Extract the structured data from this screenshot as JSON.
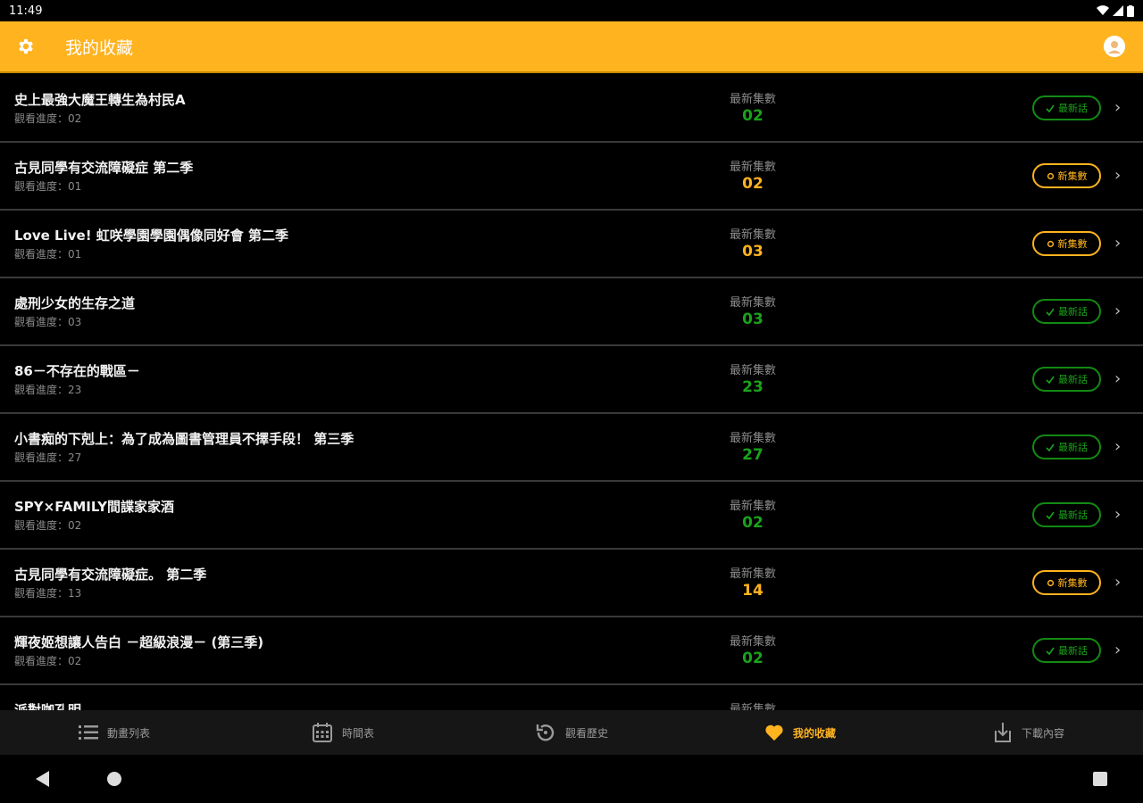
{
  "status_bar": {
    "time": "11:49"
  },
  "app_bar": {
    "title": "我的收藏"
  },
  "list": {
    "latest_label": "最新集數",
    "items": [
      {
        "name": "史上最強大魔王轉生為村民A",
        "progress": "觀看進度：02",
        "latest": "02",
        "status": "ok",
        "badge": "最新話"
      },
      {
        "name": "古見同學有交流障礙症 第二季",
        "progress": "觀看進度：01",
        "latest": "02",
        "status": "new",
        "badge": "新集數"
      },
      {
        "name": "Love Live! 虹咲學園學園偶像同好會 第二季",
        "progress": "觀看進度：01",
        "latest": "03",
        "status": "new",
        "badge": "新集數"
      },
      {
        "name": "處刑少女的生存之道",
        "progress": "觀看進度：03",
        "latest": "03",
        "status": "ok",
        "badge": "最新話"
      },
      {
        "name": "86－不存在的戰區－",
        "progress": "觀看進度：23",
        "latest": "23",
        "status": "ok",
        "badge": "最新話"
      },
      {
        "name": "小書痴的下剋上：為了成為圖書管理員不擇手段！ 第三季",
        "progress": "觀看進度：27",
        "latest": "27",
        "status": "ok",
        "badge": "最新話"
      },
      {
        "name": "SPY×FAMILY間諜家家酒",
        "progress": "觀看進度：02",
        "latest": "02",
        "status": "ok",
        "badge": "最新話"
      },
      {
        "name": "古見同學有交流障礙症。 第二季",
        "progress": "觀看進度：13",
        "latest": "14",
        "status": "new",
        "badge": "新集數"
      },
      {
        "name": "輝夜姬想讓人告白 －超級浪漫－ (第三季)",
        "progress": "觀看進度：02",
        "latest": "02",
        "status": "ok",
        "badge": "最新話"
      },
      {
        "name": "派對咖孔明",
        "progress": "",
        "latest": "",
        "status": "new",
        "badge": ""
      }
    ]
  },
  "bottom_nav": [
    {
      "label": "動畫列表",
      "icon": "list-icon",
      "active": false
    },
    {
      "label": "時間表",
      "icon": "calendar-icon",
      "active": false
    },
    {
      "label": "觀看歷史",
      "icon": "history-icon",
      "active": false
    },
    {
      "label": "我的收藏",
      "icon": "heart-icon",
      "active": true
    },
    {
      "label": "下載內容",
      "icon": "download-icon",
      "active": false
    }
  ],
  "colors": {
    "accent": "#FFB31F",
    "green": "#1aa31a",
    "background": "#000000"
  }
}
